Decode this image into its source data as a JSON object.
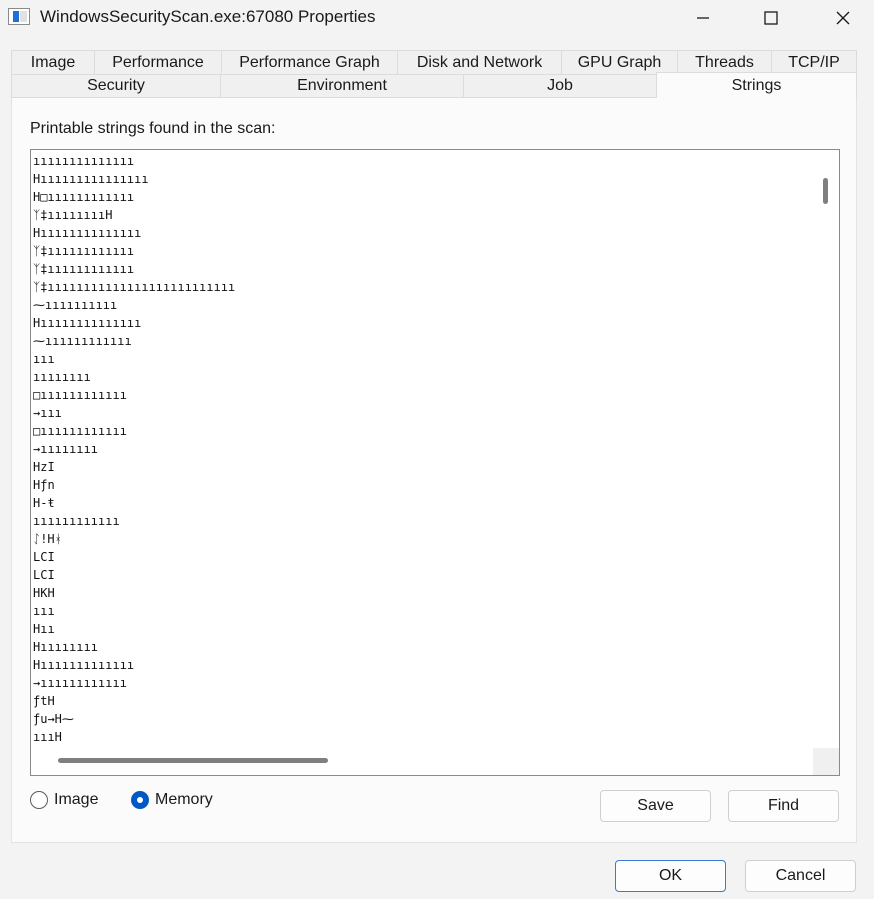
{
  "window": {
    "title": "WindowsSecurityScan.exe:67080 Properties",
    "icons": [
      "app-icon",
      "minimize-icon",
      "maximize-icon",
      "close-icon"
    ]
  },
  "tabs_row1": [
    {
      "label": "Image"
    },
    {
      "label": "Performance"
    },
    {
      "label": "Performance Graph"
    },
    {
      "label": "Disk and Network"
    },
    {
      "label": "GPU Graph"
    },
    {
      "label": "Threads"
    },
    {
      "label": "TCP/IP"
    }
  ],
  "tabs_row2": [
    {
      "label": "Security"
    },
    {
      "label": "Environment"
    },
    {
      "label": "Job"
    },
    {
      "label": "Strings"
    }
  ],
  "selected_tab": "Strings",
  "strings_panel": {
    "label": "Printable strings found in the scan:",
    "lines": [
      "ıııııııııııııı",
      "Hııııııııııııııı",
      "H□ıııııııııııı",
      "ᛉ‡ııııııııH",
      "Hıııııııııııııı",
      "ᛉ‡ıııııııııııı",
      "ᛉ‡ıııııııııııı",
      "ᛉ‡ıııııııııııııııııııııııııı",
      "⁓ıııııııııı",
      "Hıııııııııııııı",
      "⁓ıııııııııııı",
      "ııı",
      "ıııııııı",
      "□ıııııııııııı",
      "→ııı",
      "□ıııııııııııı",
      "→ıııııııı",
      "HzI",
      "Hƒn",
      "H-ŧ",
      "ıııııııııııı",
      "ᛇ!Hᚼ",
      "LCI",
      "LCI",
      "HKH",
      "ııı",
      "Hıı",
      "Hıııııııı",
      "Hııııııııııııı",
      "→ıııııııııııı",
      "ƒtH",
      "ƒu→H⁓",
      "ıııH"
    ]
  },
  "scan_source": {
    "options": [
      {
        "label": "Image",
        "checked": false
      },
      {
        "label": "Memory",
        "checked": true
      }
    ]
  },
  "buttons": {
    "save": "Save",
    "find": "Find",
    "ok": "OK",
    "cancel": "Cancel"
  },
  "colors": {
    "accent": "#0058c4",
    "window_bg": "#f3f3f3",
    "panel_bg": "#fbfbfb"
  }
}
